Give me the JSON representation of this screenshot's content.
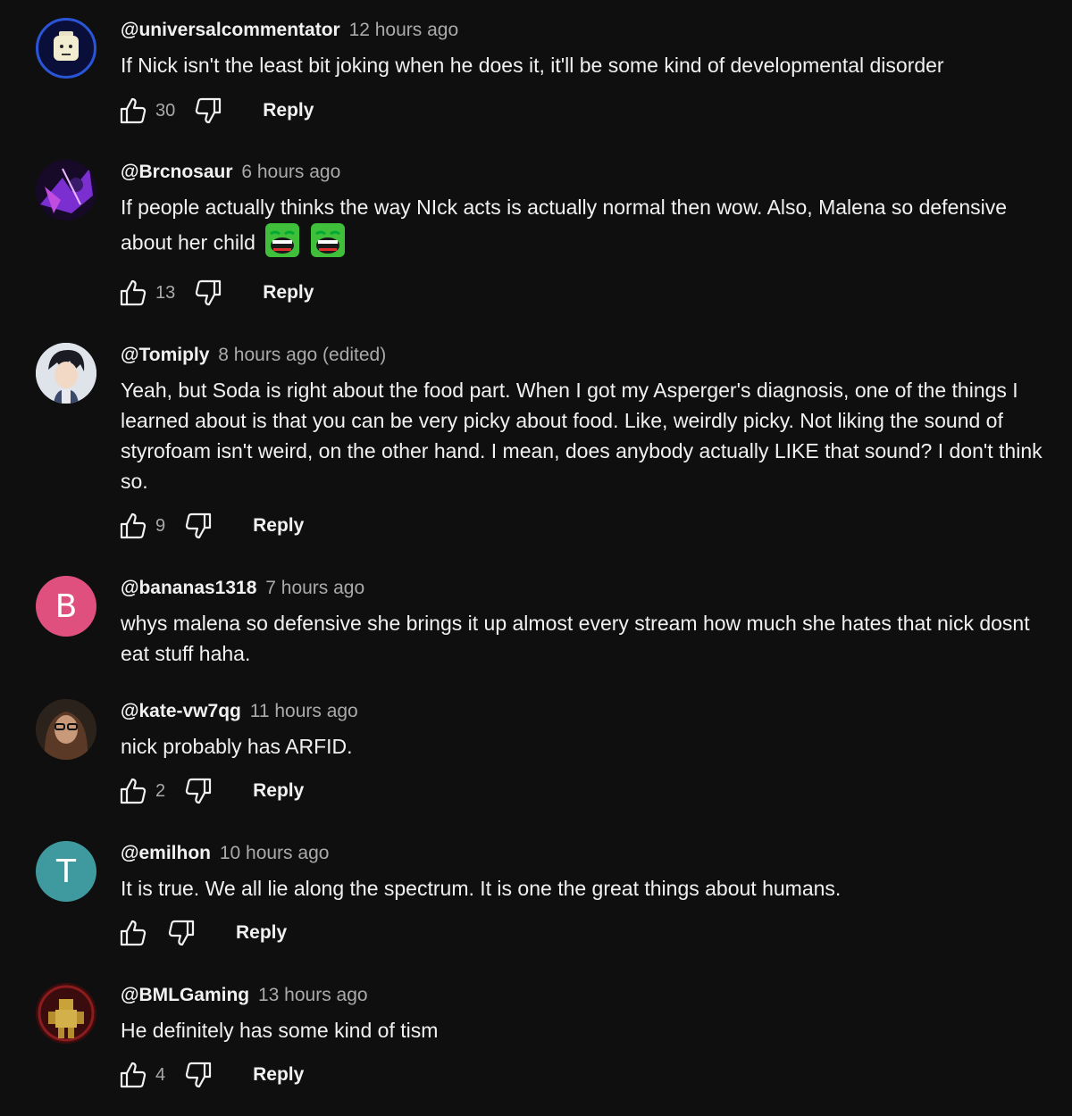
{
  "comments": [
    {
      "author": "@universalcommentator",
      "time": "12 hours ago",
      "text": "If Nick isn't the least bit joking when he does it, it'll be some kind of developmental disorder",
      "likes": "30",
      "reply": "Reply",
      "avatar_type": "lego-head"
    },
    {
      "author": "@Brcnosaur",
      "time": "6 hours ago",
      "text": "If people actually thinks the way NIck acts is actually normal then wow.  Also, Malena so defensive about her child",
      "emojis": [
        "laughing-green-emoji",
        "laughing-green-emoji"
      ],
      "likes": "13",
      "reply": "Reply",
      "avatar_type": "purple-art"
    },
    {
      "author": "@Tomiply",
      "time": "8 hours ago (edited)",
      "text": "Yeah, but Soda is right about the food part. When I got my Asperger's diagnosis, one of the things I learned about is that you can be very picky about food. Like, weirdly picky. Not liking the sound of styrofoam isn't weird, on the other hand. I mean, does anybody actually LIKE that sound? I don't think so.",
      "likes": "9",
      "reply": "Reply",
      "avatar_type": "anime-character"
    },
    {
      "author": "@bananas1318",
      "time": "7 hours ago",
      "text": "whys malena so defensive she brings it up almost every stream how much she hates that nick dosnt eat stuff haha.",
      "avatar_letter": "B",
      "avatar_color": "#e0507e"
    },
    {
      "author": "@kate-vw7qg",
      "time": "11 hours ago",
      "text": "nick probably has ARFID.",
      "likes": "2",
      "reply": "Reply",
      "avatar_type": "photo"
    },
    {
      "author": "@emilhon",
      "time": "10 hours ago",
      "text": "It is true. We all lie along the spectrum. It is one the great things about humans.",
      "likes": "",
      "reply": "Reply",
      "avatar_letter": "T",
      "avatar_color": "#3f9aa0"
    },
    {
      "author": "@BMLGaming",
      "time": "13 hours ago",
      "text": "He definitely has some kind of tism",
      "likes": "4",
      "reply": "Reply",
      "avatar_type": "robot-art"
    }
  ],
  "icons": {
    "like": "thumbs-up-icon",
    "dislike": "thumbs-down-icon"
  },
  "colors": {
    "background": "#0f0f0f",
    "text": "#f1f1f1",
    "muted": "#aaaaaa"
  }
}
